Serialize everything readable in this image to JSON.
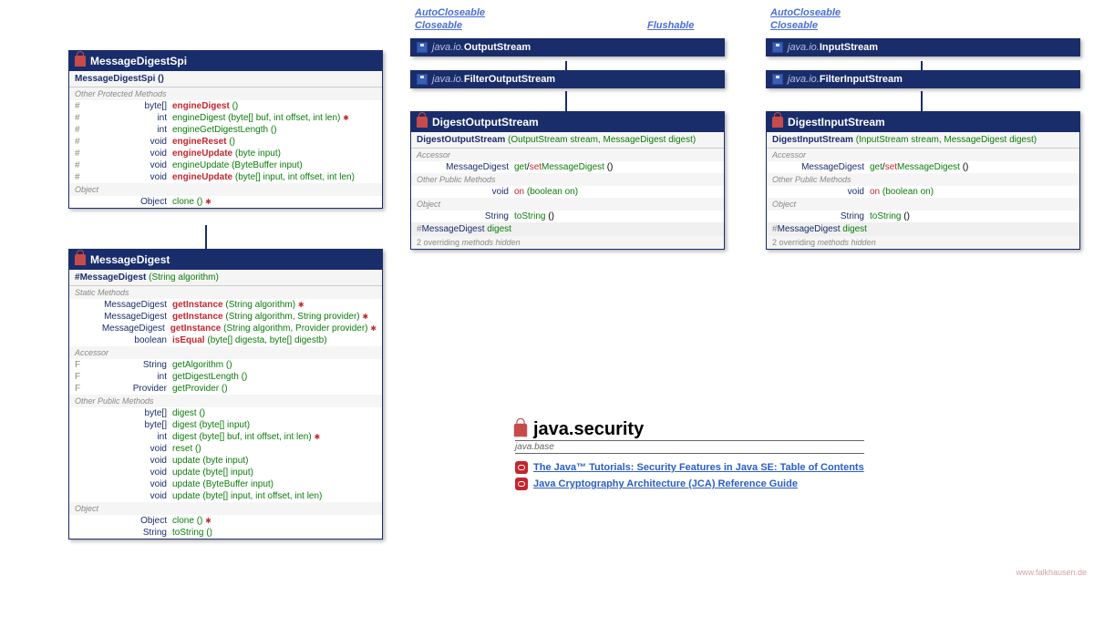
{
  "classes": {
    "mds": {
      "name": "MessageDigestSpi",
      "constructor": "MessageDigestSpi ()",
      "sections": {
        "opm": "Other Protected Methods",
        "obj": "Object"
      },
      "rows": [
        {
          "mod": "#",
          "ret": "byte[]",
          "name": "engineDigest",
          "params": "()",
          "style": "red"
        },
        {
          "mod": "#",
          "ret": "int",
          "name": "engineDigest",
          "params": "(byte[] buf, int offset, int len)",
          "style": "green",
          "exc": true
        },
        {
          "mod": "#",
          "ret": "int",
          "name": "engineGetDigestLength",
          "params": "()",
          "style": "green"
        },
        {
          "mod": "#",
          "ret": "void",
          "name": "engineReset",
          "params": "()",
          "style": "red"
        },
        {
          "mod": "#",
          "ret": "void",
          "name": "engineUpdate",
          "params": "(byte input)",
          "style": "red"
        },
        {
          "mod": "#",
          "ret": "void",
          "name": "engineUpdate",
          "params": "(ByteBuffer input)",
          "style": "green"
        },
        {
          "mod": "#",
          "ret": "void",
          "name": "engineUpdate",
          "params": "(byte[] input, int offset, int len)",
          "style": "red"
        }
      ],
      "objrows": [
        {
          "mod": "",
          "ret": "Object",
          "name": "clone",
          "params": "()",
          "style": "green",
          "exc": true
        }
      ]
    },
    "md": {
      "name": "MessageDigest",
      "constructor": "# MessageDigest (String algorithm)",
      "sections": {
        "sm": "Static Methods",
        "ac": "Accessor",
        "opm": "Other Public Methods",
        "obj": "Object"
      },
      "smrows": [
        {
          "ret": "MessageDigest",
          "name": "getInstance",
          "params": "(String algorithm)",
          "exc": true
        },
        {
          "ret": "MessageDigest",
          "name": "getInstance",
          "params": "(String algorithm, String provider)",
          "exc": true
        },
        {
          "ret": "MessageDigest",
          "name": "getInstance",
          "params": "(String algorithm, Provider provider)",
          "exc": true
        },
        {
          "ret": "boolean",
          "name": "isEqual",
          "params": "(byte[] digesta, byte[] digestb)"
        }
      ],
      "acrows": [
        {
          "mod": "F",
          "ret": "String",
          "name": "getAlgorithm",
          "params": "()"
        },
        {
          "mod": "F",
          "ret": "int",
          "name": "getDigestLength",
          "params": "()"
        },
        {
          "mod": "F",
          "ret": "Provider",
          "name": "getProvider",
          "params": "()"
        }
      ],
      "oprows": [
        {
          "ret": "byte[]",
          "name": "digest",
          "params": "()"
        },
        {
          "ret": "byte[]",
          "name": "digest",
          "params": "(byte[] input)"
        },
        {
          "ret": "int",
          "name": "digest",
          "params": "(byte[] buf, int offset, int len)",
          "exc": true
        },
        {
          "ret": "void",
          "name": "reset",
          "params": "()"
        },
        {
          "ret": "void",
          "name": "update",
          "params": "(byte input)"
        },
        {
          "ret": "void",
          "name": "update",
          "params": "(byte[] input)"
        },
        {
          "ret": "void",
          "name": "update",
          "params": "(ByteBuffer input)"
        },
        {
          "ret": "void",
          "name": "update",
          "params": "(byte[] input, int offset, int len)"
        }
      ],
      "objrows": [
        {
          "ret": "Object",
          "name": "clone",
          "params": "()",
          "exc": true
        },
        {
          "ret": "String",
          "name": "toString",
          "params": "()"
        }
      ]
    },
    "os": {
      "pkg": "java.io.",
      "name": "OutputStream"
    },
    "fos": {
      "pkg": "java.io.",
      "name": "FilterOutputStream"
    },
    "is": {
      "pkg": "java.io.",
      "name": "InputStream"
    },
    "fis": {
      "pkg": "java.io.",
      "name": "FilterInputStream"
    },
    "dos": {
      "name": "DigestOutputStream",
      "constructor": "DigestOutputStream (OutputStream stream, MessageDigest digest)",
      "sections": {
        "ac": "Accessor",
        "opm": "Other Public Methods",
        "obj": "Object"
      },
      "acrow": {
        "ret": "MessageDigest",
        "name": "get/setMessageDigest ()"
      },
      "oprow": {
        "ret": "void",
        "name": "on",
        "params": "(boolean on)"
      },
      "objrow": {
        "ret": "String",
        "name": "toString",
        "params": "()"
      },
      "field": "# MessageDigest  digest",
      "hidden": "2 overriding methods hidden"
    },
    "dis": {
      "name": "DigestInputStream",
      "constructor": "DigestInputStream (InputStream stream, MessageDigest digest)",
      "sections": {
        "ac": "Accessor",
        "opm": "Other Public Methods",
        "obj": "Object"
      },
      "acrow": {
        "ret": "MessageDigest",
        "name": "get/setMessageDigest ()"
      },
      "oprow": {
        "ret": "void",
        "name": "on",
        "params": "(boolean on)"
      },
      "objrow": {
        "ret": "String",
        "name": "toString",
        "params": "()"
      },
      "field": "# MessageDigest  digest",
      "hidden": "2 overriding methods hidden"
    }
  },
  "interfaces": {
    "ac1": "AutoCloseable",
    "cl1": "Closeable",
    "fl": "Flushable",
    "ac2": "AutoCloseable",
    "cl2": "Closeable"
  },
  "package": {
    "name": "java.security",
    "module": "java.base",
    "links": [
      "The Java™ Tutorials: Security Features in Java SE: Table of Contents",
      "Java Cryptography Architecture (JCA) Reference Guide"
    ]
  },
  "credit": "www.falkhausen.de"
}
